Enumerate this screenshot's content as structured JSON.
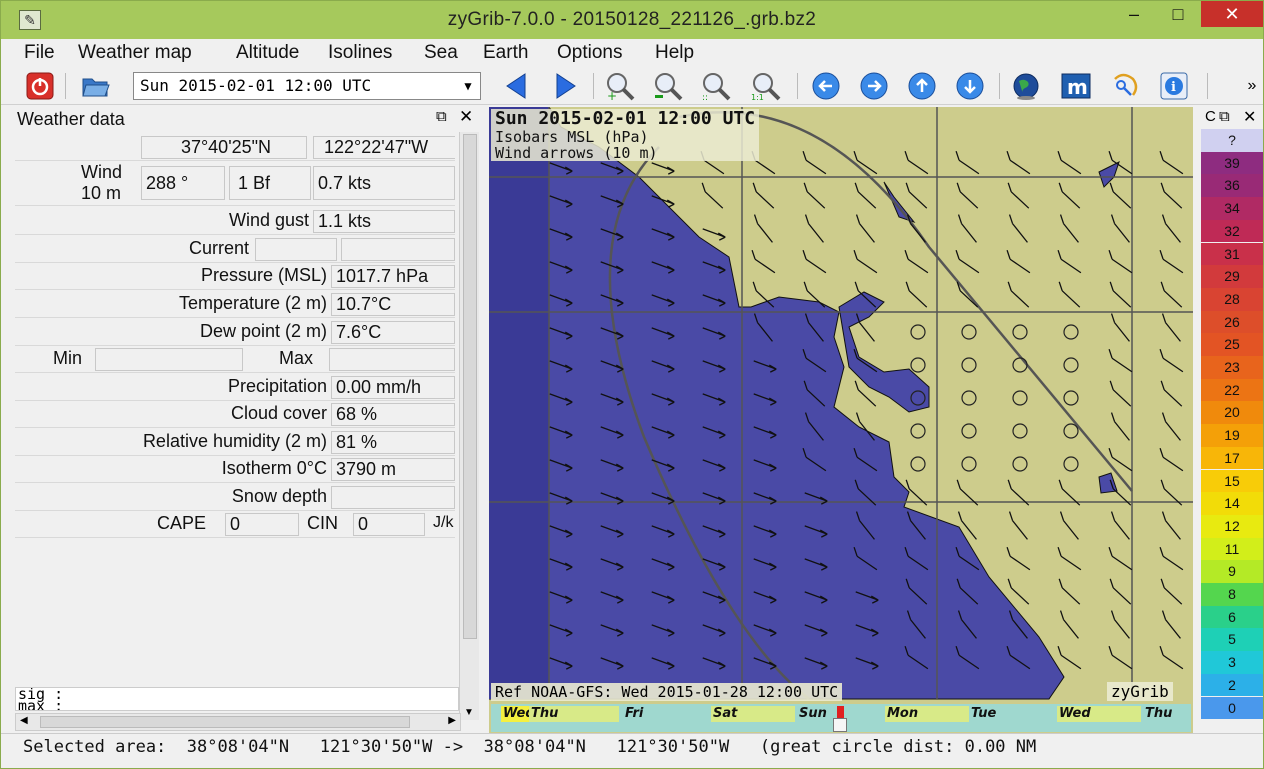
{
  "window": {
    "title": "zyGrib-7.0.0 - 20150128_221126_.grb.bz2",
    "minimize": "–",
    "maximize": "□",
    "close": "✕"
  },
  "menu": [
    "File",
    "Weather map",
    "Altitude",
    "Isolines",
    "Sea",
    "Earth",
    "Options",
    "Help"
  ],
  "toolbar": {
    "date_value": "Sun 2015-02-01 12:00 UTC",
    "overflow": "»",
    "icons": [
      "power-icon",
      "open-folder-icon",
      "arrow-left-icon",
      "arrow-right-icon",
      "zoom-in-icon",
      "zoom-out-icon",
      "zoom-fit-icon",
      "zoom-1to1-icon",
      "circle-left-icon",
      "circle-right-icon",
      "circle-up-icon",
      "circle-down-icon",
      "globe-icon",
      "meteoblue-icon",
      "select-area-icon",
      "info-icon"
    ]
  },
  "weather_data": {
    "title": "Weather data",
    "float_icon": "⧉",
    "close_icon": "✕",
    "lat": "37°40'25\"N",
    "lon": "122°22'47\"W",
    "wind_label_1": "Wind",
    "wind_label_2": "10 m",
    "wind_dir": "288 °",
    "wind_bf": "1 Bf",
    "wind_speed": "0.7  kts",
    "gust_label": "Wind gust",
    "gust_value": "1.1  kts",
    "current_label": "Current",
    "current_value1": "",
    "current_value2": "",
    "pressure_label": "Pressure (MSL)",
    "pressure_value": "1017.7 hPa",
    "temp_label": "Temperature (2 m)",
    "temp_value": "10.7°C",
    "dew_label": "Dew point (2 m)",
    "dew_value": "7.6°C",
    "min_label": "Min",
    "min_value": "",
    "max_label": "Max",
    "max_value": "",
    "precip_label": "Precipitation",
    "precip_value": "0.00 mm/h",
    "cloud_label": "Cloud cover",
    "cloud_value": "68 %",
    "rh_label": "Relative humidity (2 m)",
    "rh_value": "81 %",
    "iso_label": "Isotherm 0°C",
    "iso_value": "3790 m",
    "snow_label": "Snow depth",
    "snow_value": "",
    "cape_label": "CAPE",
    "cape_value": "0",
    "cin_label": "CIN",
    "cin_value": "0",
    "cape_unit": "J/k",
    "sig_line1": "sig  :",
    "sig_line2": "max  :"
  },
  "map": {
    "date": "Sun 2015-02-01 12:00 UTC",
    "line1": "Isobars MSL (hPa)",
    "line2": "Wind arrows (10 m)",
    "ref": "Ref NOAA-GFS: Wed 2015-01-28 12:00 UTC",
    "brand": "zyGrib",
    "colors": {
      "sea": "#4a4aa6",
      "land": "#cdcc8c",
      "isobar": "#555555"
    }
  },
  "timeline": {
    "days": [
      "Wed",
      "Thu",
      "Fri",
      "Sat",
      "Sun",
      "Mon",
      "Tue",
      "Wed",
      "Thu"
    ],
    "current_day_index": 4
  },
  "scale": {
    "header": "C",
    "float_icon": "⧉",
    "close_icon": "✕",
    "unknown": "?",
    "values": [
      "39",
      "36",
      "34",
      "32",
      "31",
      "29",
      "28",
      "26",
      "25",
      "23",
      "22",
      "20",
      "19",
      "17",
      "15",
      "14",
      "12",
      "11",
      "9",
      "8",
      "6",
      "5",
      "3",
      "2",
      "0"
    ],
    "colors": [
      "#8e2c80",
      "#992a76",
      "#b02a64",
      "#bf2a56",
      "#c9304a",
      "#d23a3c",
      "#d94432",
      "#dd4e2a",
      "#e35424",
      "#e8641c",
      "#ec7414",
      "#f08a0c",
      "#f4a008",
      "#f8b608",
      "#f8cc08",
      "#f2dc08",
      "#e8ea10",
      "#d2ee1a",
      "#b4ea26",
      "#54d64e",
      "#2ad08a",
      "#1ed0b6",
      "#20c8d8",
      "#2cb0e8",
      "#4a98ec"
    ]
  },
  "status": {
    "text": "Selected area:  38°08'04\"N   121°30'50\"W ->  38°08'04\"N   121°30'50\"W   (great circle dist: 0.00 NM"
  }
}
